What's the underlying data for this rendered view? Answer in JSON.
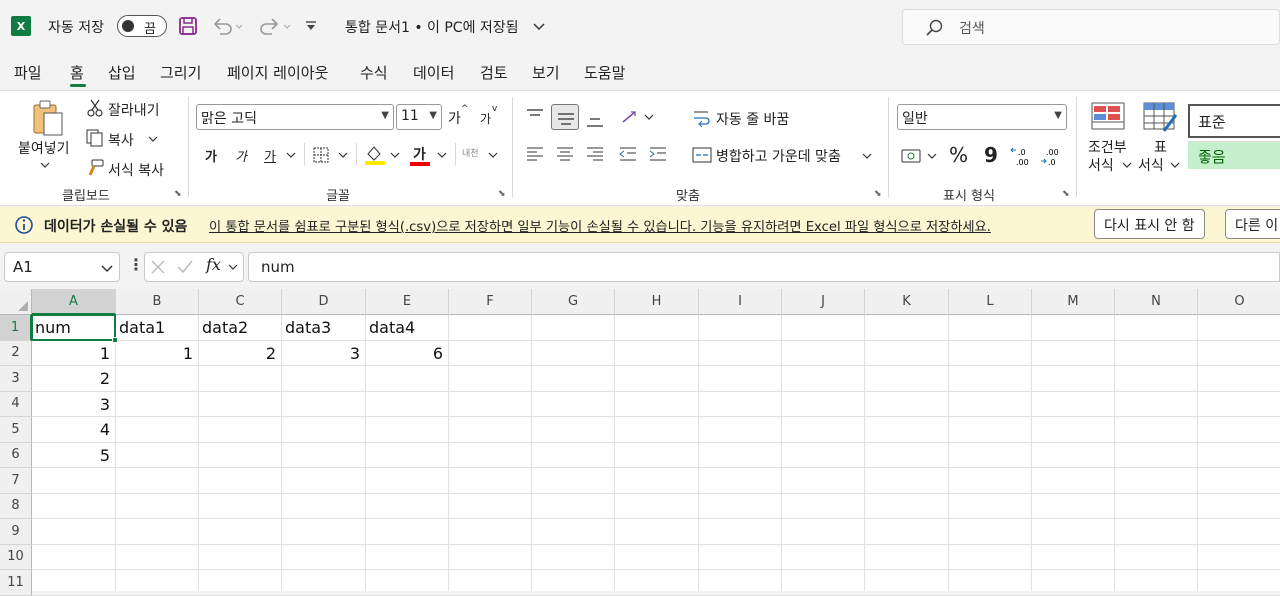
{
  "titlebar": {
    "autosave_label": "자동 저장",
    "autosave_state": "끔",
    "doc_title": "통합 문서1 • 이 PC에 저장됨",
    "search_placeholder": "검색"
  },
  "menu": [
    "파일",
    "홈",
    "삽입",
    "그리기",
    "페이지 레이아웃",
    "수식",
    "데이터",
    "검토",
    "보기",
    "도움말"
  ],
  "ribbon": {
    "clipboard": {
      "paste": "붙여넣기",
      "cut": "잘라내기",
      "copy": "복사",
      "format_painter": "서식 복사",
      "label": "클립보드"
    },
    "font": {
      "font_name": "맑은 고딕",
      "font_size": "11",
      "grow": "가",
      "shrink": "가",
      "bold": "가",
      "italic": "가",
      "underline": "가",
      "font_color": "가",
      "phonetic": "내천",
      "label": "글꼴"
    },
    "alignment": {
      "wrap": "자동 줄 바꿈",
      "merge": "병합하고 가운데 맞춤",
      "label": "맞춤"
    },
    "number": {
      "format": "일반",
      "percent": "%",
      "comma": "9",
      "label": "표시 형식"
    },
    "styles": {
      "conditional_1": "조건부",
      "conditional_2": "서식",
      "table_1": "표",
      "table_2": "서식",
      "style_normal": "표준",
      "style_good": "좋음"
    }
  },
  "message_bar": {
    "title": "데이터가 손실될 수 있음",
    "text": "이 통합 문서를 쉼표로 구분된 형식(.csv)으로 저장하면 일부 기능이 손실될 수 있습니다. 기능을 유지하려면 Excel 파일 형식으로 저장하세요.",
    "dont_show": "다시 표시 안 함",
    "save_as": "다른 이"
  },
  "formula_bar": {
    "name_box": "A1",
    "fx": "fx",
    "content": "num"
  },
  "grid": {
    "columns": [
      "A",
      "B",
      "C",
      "D",
      "E",
      "F",
      "G",
      "H",
      "I",
      "J",
      "K",
      "L",
      "M",
      "N",
      "O"
    ],
    "rows": [
      "1",
      "2",
      "3",
      "4",
      "5",
      "6",
      "7",
      "8",
      "9",
      "10",
      "11"
    ],
    "cells": {
      "A1": "num",
      "B1": "data1",
      "C1": "data2",
      "D1": "data3",
      "E1": "data4",
      "A2": "1",
      "B2": "1",
      "C2": "2",
      "D2": "3",
      "E2": "6",
      "A3": "2",
      "A4": "3",
      "A5": "4",
      "A6": "5"
    },
    "selected": "A1"
  }
}
